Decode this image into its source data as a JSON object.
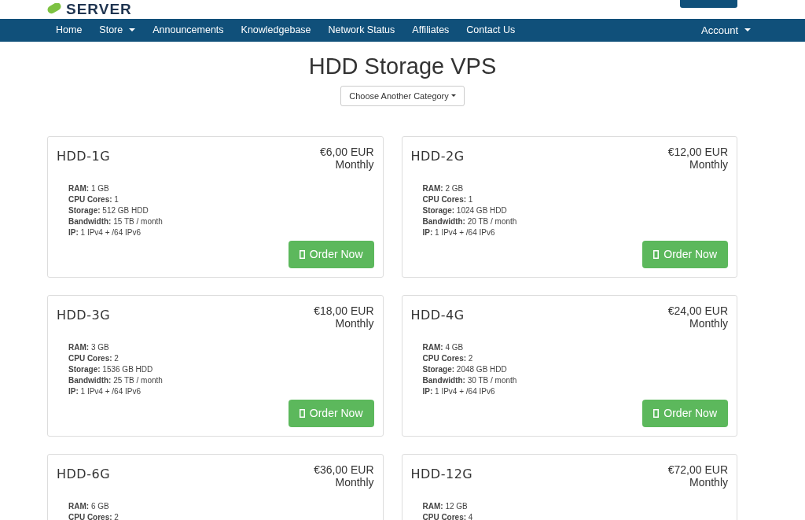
{
  "logo": {
    "text": "SERVER"
  },
  "nav": {
    "items": [
      {
        "label": "Home",
        "dropdown": false
      },
      {
        "label": "Store",
        "dropdown": true
      },
      {
        "label": "Announcements",
        "dropdown": false
      },
      {
        "label": "Knowledgebase",
        "dropdown": false
      },
      {
        "label": "Network Status",
        "dropdown": false
      },
      {
        "label": "Affiliates",
        "dropdown": false
      },
      {
        "label": "Contact Us",
        "dropdown": false
      }
    ],
    "account": {
      "label": "Account",
      "dropdown": true
    }
  },
  "page": {
    "title": "HDD Storage VPS",
    "category_button": "Choose Another Category"
  },
  "products": [
    {
      "name": "HDD-1G",
      "price": "€6,00 EUR",
      "cycle": "Monthly",
      "features": [
        "**RAM:** 1 GB",
        "**CPU Cores:** 1",
        "**Storage:** 512 GB HDD",
        "**Bandwidth:** 15 TB / month",
        "**IP:** 1 IPv4 + /64 IPv6"
      ],
      "button": "Order Now"
    },
    {
      "name": "HDD-2G",
      "price": "€12,00 EUR",
      "cycle": "Monthly",
      "features": [
        "**RAM:** 2 GB",
        "**CPU Cores:** 1",
        "**Storage:** 1024 GB HDD",
        "**Bandwidth:** 20 TB / month",
        "**IP:** 1 IPv4 + /64 IPv6"
      ],
      "button": "Order Now"
    },
    {
      "name": "HDD-3G",
      "price": "€18,00 EUR",
      "cycle": "Monthly",
      "features": [
        "**RAM:** 3 GB",
        "**CPU Cores:** 2",
        "**Storage:** 1536 GB HDD",
        "**Bandwidth:** 25 TB / month",
        "**IP:** 1 IPv4 + /64 IPv6"
      ],
      "button": "Order Now"
    },
    {
      "name": "HDD-4G",
      "price": "€24,00 EUR",
      "cycle": "Monthly",
      "features": [
        "**RAM:** 4 GB",
        "**CPU Cores:** 2",
        "**Storage:** 2048 GB HDD",
        "**Bandwidth:** 30 TB / month",
        "**IP:** 1 IPv4 + /64 IPv6"
      ],
      "button": "Order Now"
    },
    {
      "name": "HDD-6G",
      "price": "€36,00 EUR",
      "cycle": "Monthly",
      "features": [
        "**RAM:** 6 GB",
        "**CPU Cores:** 2"
      ]
    },
    {
      "name": "HDD-12G",
      "price": "€72,00 EUR",
      "cycle": "Monthly",
      "features": [
        "**RAM:** 12 GB",
        "**CPU Cores:** 4"
      ]
    }
  ]
}
